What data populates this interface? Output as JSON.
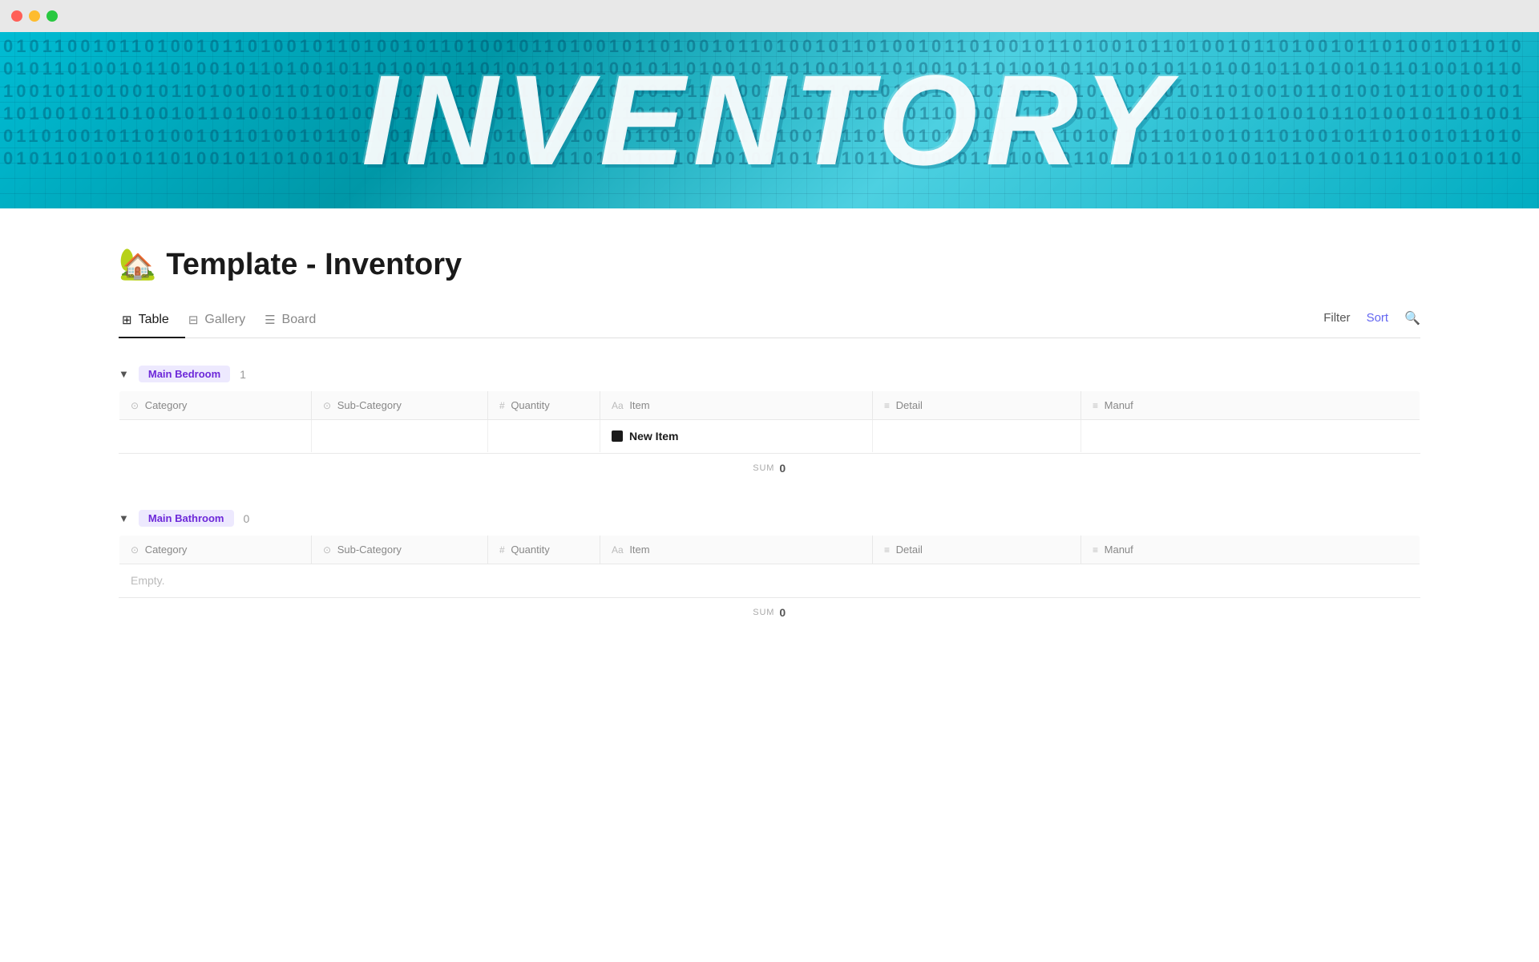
{
  "titlebar": {
    "close": "close",
    "minimize": "minimize",
    "maximize": "maximize"
  },
  "hero": {
    "text": "INVENTORY",
    "numbers": "0 1 0 1 1 0 0 1 0 1 1 0 1 0 1 0 0 1 1 0 1 0 0 1 1 0 1 1 0 0 1 0"
  },
  "page": {
    "emoji": "🏡",
    "title": "Template - Inventory"
  },
  "tabs": [
    {
      "id": "table",
      "label": "Table",
      "icon": "⊞",
      "active": true
    },
    {
      "id": "gallery",
      "label": "Gallery",
      "icon": "⊟",
      "active": false
    },
    {
      "id": "board",
      "label": "Board",
      "icon": "☰",
      "active": false
    }
  ],
  "toolbar": {
    "filter_label": "Filter",
    "sort_label": "Sort",
    "search_icon": "🔍"
  },
  "columns": [
    {
      "id": "category",
      "label": "Category",
      "icon": "⊙"
    },
    {
      "id": "subcategory",
      "label": "Sub-Category",
      "icon": "⊙"
    },
    {
      "id": "quantity",
      "label": "Quantity",
      "icon": "#"
    },
    {
      "id": "item",
      "label": "Item",
      "icon": "Aa"
    },
    {
      "id": "detail",
      "label": "Detail",
      "icon": "≡"
    },
    {
      "id": "manufacturer",
      "label": "Manuf",
      "icon": "≡"
    }
  ],
  "groups": [
    {
      "id": "main-bedroom",
      "name": "Main Bedroom",
      "count": 1,
      "expanded": true,
      "rows": [
        {
          "id": "new-item-row",
          "category": "",
          "subcategory": "",
          "quantity": "",
          "item": "New Item",
          "detail": "",
          "manufacturer": "",
          "is_new": true
        }
      ],
      "sum": 0,
      "empty": false
    },
    {
      "id": "main-bathroom",
      "name": "Main Bathroom",
      "count": 0,
      "expanded": true,
      "rows": [],
      "sum": 0,
      "empty": true,
      "empty_label": "Empty."
    }
  ]
}
